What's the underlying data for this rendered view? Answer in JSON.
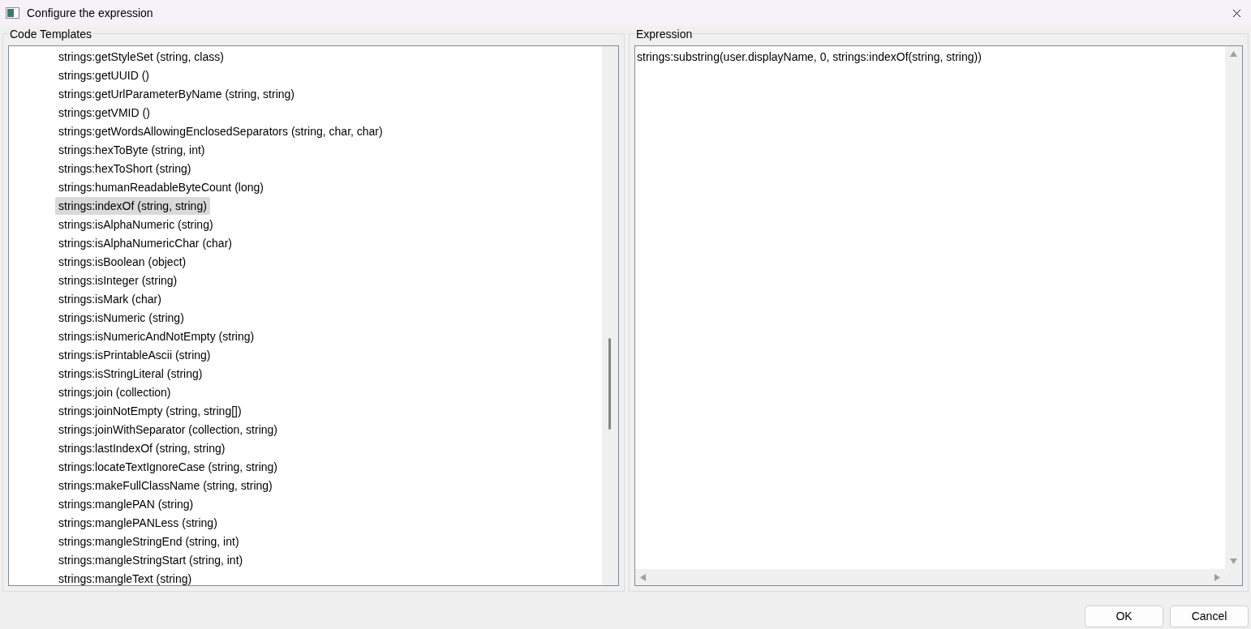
{
  "window": {
    "title": "Configure the expression"
  },
  "code_templates": {
    "title": "Code Templates",
    "items": [
      {
        "label": "strings:getStyleSet (string, class)",
        "selected": false
      },
      {
        "label": "strings:getUUID ()",
        "selected": false
      },
      {
        "label": "strings:getUrlParameterByName (string, string)",
        "selected": false
      },
      {
        "label": "strings:getVMID ()",
        "selected": false
      },
      {
        "label": "strings:getWordsAllowingEnclosedSeparators (string, char, char)",
        "selected": false
      },
      {
        "label": "strings:hexToByte (string, int)",
        "selected": false
      },
      {
        "label": "strings:hexToShort (string)",
        "selected": false
      },
      {
        "label": "strings:humanReadableByteCount (long)",
        "selected": false
      },
      {
        "label": "strings:indexOf (string, string)",
        "selected": true
      },
      {
        "label": "strings:isAlphaNumeric (string)",
        "selected": false
      },
      {
        "label": "strings:isAlphaNumericChar (char)",
        "selected": false
      },
      {
        "label": "strings:isBoolean (object)",
        "selected": false
      },
      {
        "label": "strings:isInteger (string)",
        "selected": false
      },
      {
        "label": "strings:isMark (char)",
        "selected": false
      },
      {
        "label": "strings:isNumeric (string)",
        "selected": false
      },
      {
        "label": "strings:isNumericAndNotEmpty (string)",
        "selected": false
      },
      {
        "label": "strings:isPrintableAscii (string)",
        "selected": false
      },
      {
        "label": "strings:isStringLiteral (string)",
        "selected": false
      },
      {
        "label": "strings:join (collection)",
        "selected": false
      },
      {
        "label": "strings:joinNotEmpty (string, string[])",
        "selected": false
      },
      {
        "label": "strings:joinWithSeparator (collection, string)",
        "selected": false
      },
      {
        "label": "strings:lastIndexOf (string, string)",
        "selected": false
      },
      {
        "label": "strings:locateTextIgnoreCase (string, string)",
        "selected": false
      },
      {
        "label": "strings:makeFullClassName (string, string)",
        "selected": false
      },
      {
        "label": "strings:manglePAN (string)",
        "selected": false
      },
      {
        "label": "strings:manglePANLess (string)",
        "selected": false
      },
      {
        "label": "strings:mangleStringEnd (string, int)",
        "selected": false
      },
      {
        "label": "strings:mangleStringStart (string, int)",
        "selected": false
      },
      {
        "label": "strings:mangleText (string)",
        "selected": false
      }
    ]
  },
  "expression": {
    "title": "Expression",
    "value": "strings:substring(user.displayName, 0, strings:indexOf(string, string))"
  },
  "buttons": [
    "OK",
    "Cancel"
  ]
}
